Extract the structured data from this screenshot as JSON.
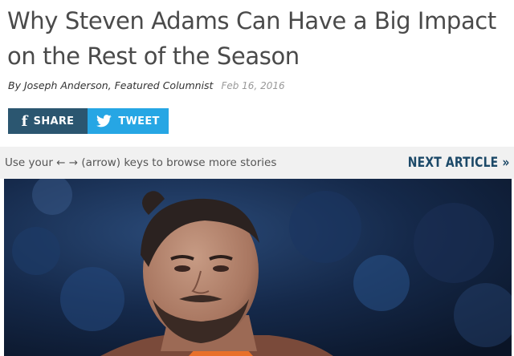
{
  "article": {
    "title": "Why Steven Adams Can Have a Big Impact on the Rest of the Season",
    "byline_prefix": "By",
    "author": "Joseph Anderson, Featured Columnist",
    "date": "Feb 16, 2016"
  },
  "share": {
    "share_label": "SHARE",
    "tweet_label": "TWEET",
    "share_icon": "facebook-f-icon",
    "tweet_icon": "twitter-bird-icon",
    "share_color": "#2b5670",
    "tweet_color": "#26a6e4"
  },
  "navigation": {
    "hint": "Use your ← → (arrow) keys to browse more stories",
    "next_label": "NEXT ARTICLE »"
  },
  "hero_image": {
    "subject": "basketball player photo"
  },
  "colors": {
    "headline": "#4a4a4a",
    "nav_background": "#f1f1f1",
    "next_link": "#1c4968"
  }
}
